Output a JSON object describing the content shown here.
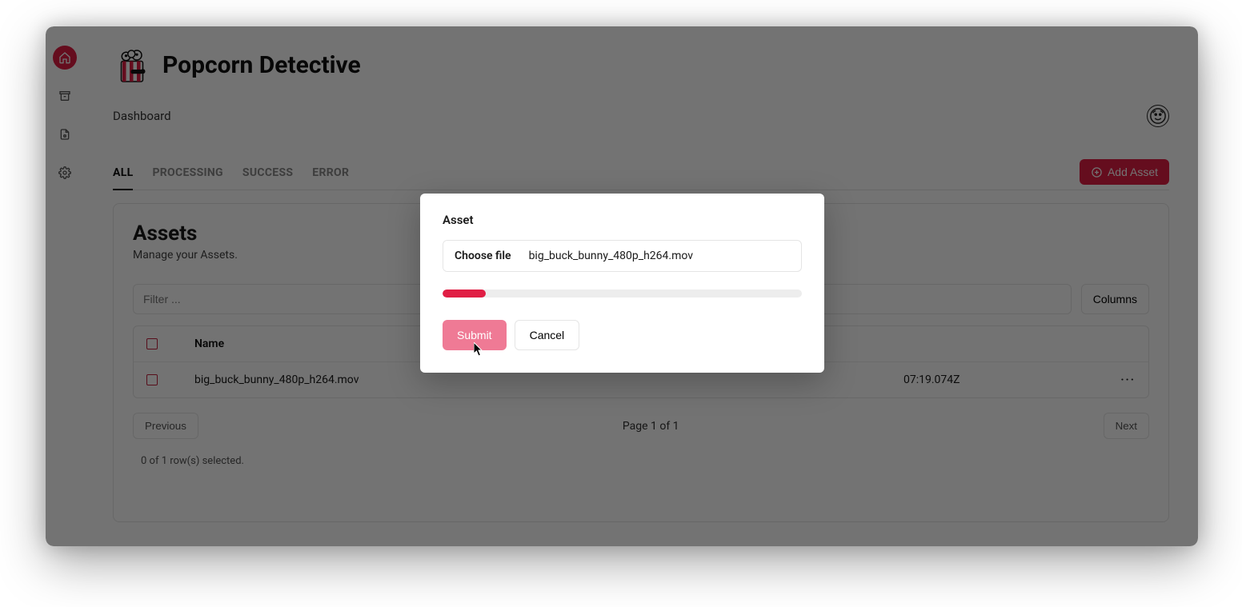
{
  "brand": {
    "title": "Popcorn Detective"
  },
  "breadcrumb": "Dashboard",
  "tabs": [
    "ALL",
    "PROCESSING",
    "SUCCESS",
    "ERROR"
  ],
  "active_tab_index": 0,
  "add_asset_label": "Add Asset",
  "card": {
    "title": "Assets",
    "subtitle": "Manage your Assets.",
    "filter_placeholder": "Filter ...",
    "columns_button": "Columns"
  },
  "table": {
    "columns": {
      "name": "Name"
    },
    "rows": [
      {
        "name": "big_buck_bunny_480p_h264.mov",
        "date_fragment": "07:19.074Z"
      }
    ]
  },
  "pager": {
    "prev": "Previous",
    "label": "Page 1 of 1",
    "next": "Next"
  },
  "selected_note": "0 of 1 row(s) selected.",
  "modal": {
    "title": "Asset",
    "choose_label": "Choose file",
    "filename": "big_buck_bunny_480p_h264.mov",
    "progress_percent": 12,
    "submit": "Submit",
    "cancel": "Cancel"
  },
  "colors": {
    "accent": "#e01e44"
  }
}
